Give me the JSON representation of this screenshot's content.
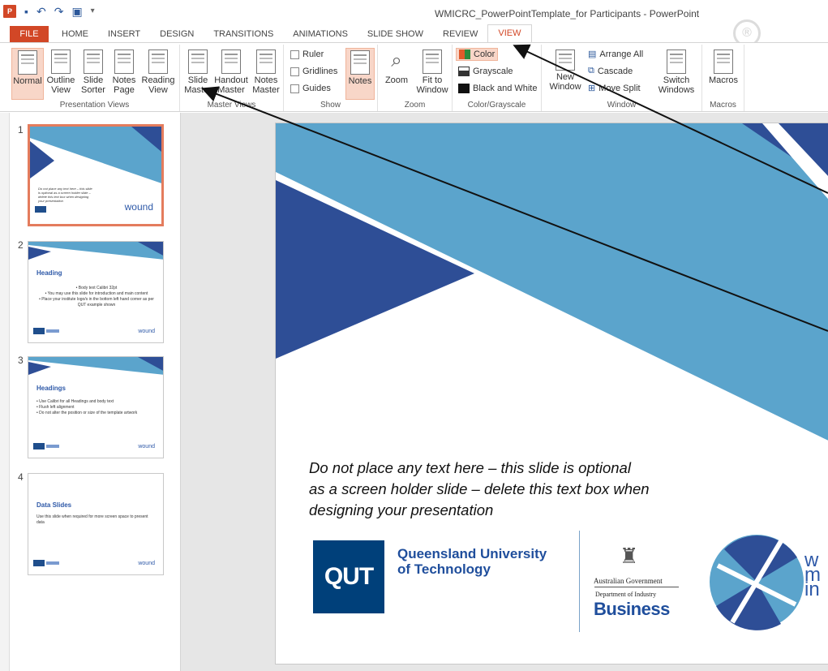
{
  "window": {
    "title": "WMICRC_PowerPointTemplate_for Participants - PowerPoint",
    "app_badge": "P",
    "accent": "#d24726"
  },
  "qat": {
    "icons": [
      "save-icon",
      "undo-icon",
      "redo-icon",
      "present-icon",
      "customize-icon"
    ]
  },
  "tabs": [
    "FILE",
    "HOME",
    "INSERT",
    "DESIGN",
    "TRANSITIONS",
    "ANIMATIONS",
    "SLIDE SHOW",
    "REVIEW",
    "VIEW"
  ],
  "active_tab": "VIEW",
  "ribbon": {
    "presentation_views": {
      "label": "Presentation Views",
      "normal": "Normal",
      "outline": "Outline View",
      "sorter": "Slide Sorter",
      "notes_page": "Notes Page",
      "reading": "Reading View"
    },
    "master_views": {
      "label": "Master Views",
      "slide": "Slide Master",
      "handout": "Handout Master",
      "notes": "Notes Master"
    },
    "show": {
      "label": "Show",
      "ruler": "Ruler",
      "gridlines": "Gridlines",
      "guides": "Guides",
      "notes": "Notes"
    },
    "zoom": {
      "label": "Zoom",
      "zoom": "Zoom",
      "fit": "Fit to Window"
    },
    "color": {
      "label": "Color/Grayscale",
      "color": "Color",
      "grayscale": "Grayscale",
      "bw": "Black and White"
    },
    "window": {
      "label": "Window",
      "new_window": "New Window",
      "arrange_all": "Arrange All",
      "cascade": "Cascade",
      "move_split": "Move Split",
      "switch": "Switch Windows"
    },
    "macros": {
      "label": "Macros",
      "macros": "Macros"
    }
  },
  "slides": [
    {
      "num": "1",
      "note": "Do not place any text here – this slide is optional as a screen holder slide – delete this text box when designing your presentation"
    },
    {
      "num": "2",
      "heading": "Heading",
      "body": "• Body text Calibri 32pt\n• You may use this slide for introduction and main content\n• Place your institute logo/s in the bottom left hand corner as per QUT example shown"
    },
    {
      "num": "3",
      "heading": "Headings",
      "body": "• Use Calibri for all Headings and body text\n• Flush left alignment\n• Do not alter the position or size of the template artwork"
    },
    {
      "num": "4",
      "heading": "Data Slides",
      "body": "Use this slide when required for more screen space to present data"
    }
  ],
  "main_slide": {
    "note": "Do not place any text here – this slide is optional as a screen holder slide – delete this text box when designing your presentation",
    "qut_logo": "QUT",
    "qut_name": "Queensland University\nof Technology",
    "gov_line1": "Australian Government",
    "gov_line2": "Department of Industry",
    "gov_line3": "Business",
    "wound_text": "w\nm\nin",
    "colors": {
      "dark_blue": "#2e4e96",
      "light_blue": "#5ba4cc"
    }
  },
  "thumb_wound": "wound"
}
